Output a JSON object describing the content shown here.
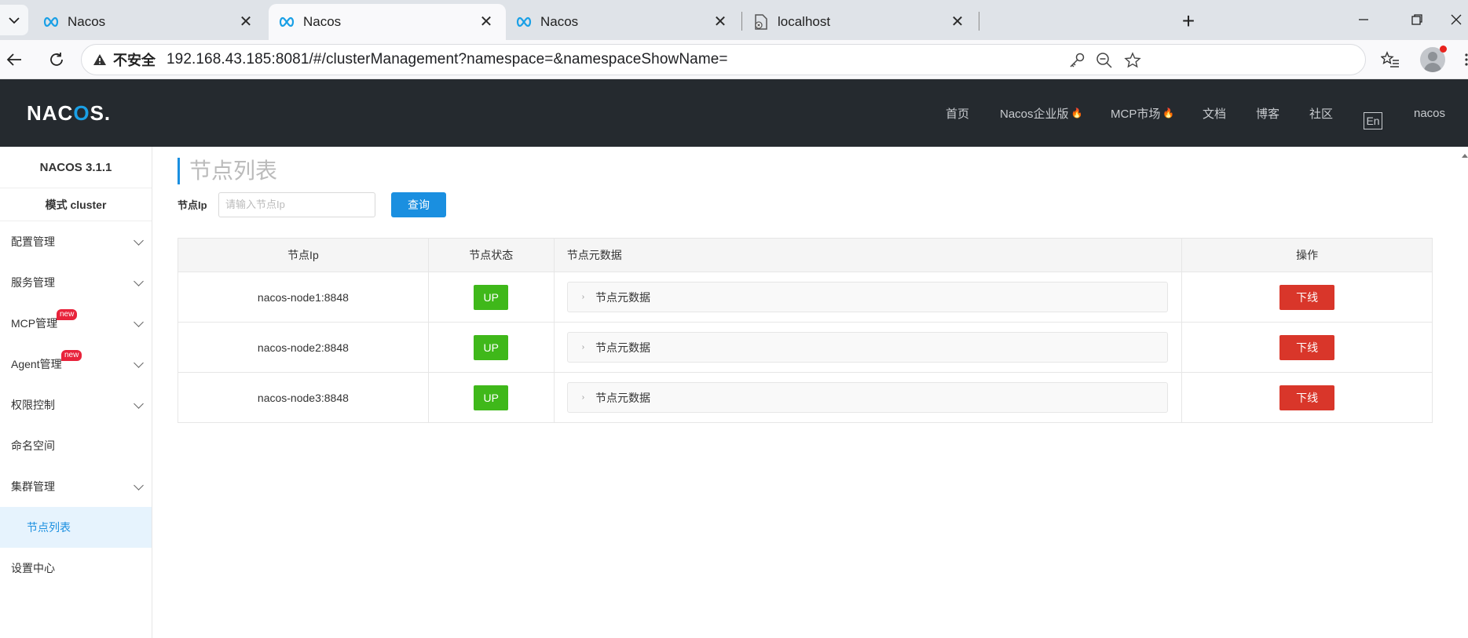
{
  "browser": {
    "tabs": [
      {
        "title": "Nacos",
        "active": false
      },
      {
        "title": "Nacos",
        "active": true
      },
      {
        "title": "Nacos",
        "active": false
      },
      {
        "title": "localhost",
        "active": false
      }
    ],
    "close_glyph": "✕",
    "new_tab_glyph": "+",
    "security_label": "不安全",
    "url": "192.168.43.185:8081/#/clusterManagement?namespace=&namespaceShowName="
  },
  "header": {
    "logo_prefix": "NAC",
    "logo_o": "O",
    "logo_suffix": "S.",
    "nav": {
      "home": "首页",
      "enterprise": "Nacos企业版",
      "mcp_market": "MCP市场",
      "docs": "文档",
      "blog": "博客",
      "community": "社区",
      "lang": "En",
      "user": "nacos"
    },
    "fire_glyph": "🔥",
    "brand_color": "#1aa0e6"
  },
  "sidebar": {
    "version": "NACOS 3.1.1",
    "mode": "模式 cluster",
    "items": [
      {
        "label": "配置管理"
      },
      {
        "label": "服务管理"
      },
      {
        "label": "MCP管理",
        "badge": "new"
      },
      {
        "label": "Agent管理",
        "badge": "new"
      },
      {
        "label": "权限控制"
      },
      {
        "label": "命名空间"
      },
      {
        "label": "集群管理"
      },
      {
        "label": "节点列表"
      },
      {
        "label": "设置中心"
      }
    ]
  },
  "main": {
    "title": "节点列表",
    "filter": {
      "label": "节点Ip",
      "placeholder": "请输入节点Ip",
      "button": "查询"
    },
    "table": {
      "columns": [
        "节点Ip",
        "节点状态",
        "节点元数据",
        "操作"
      ],
      "rows": [
        {
          "ip": "nacos-node1:8848",
          "status": "UP",
          "meta": "节点元数据",
          "action": "下线"
        },
        {
          "ip": "nacos-node2:8848",
          "status": "UP",
          "meta": "节点元数据",
          "action": "下线"
        },
        {
          "ip": "nacos-node3:8848",
          "status": "UP",
          "meta": "节点元数据",
          "action": "下线"
        }
      ]
    },
    "colors": {
      "primary": "#1a8fe0",
      "up": "#3fb81a",
      "danger": "#d9362a"
    }
  }
}
